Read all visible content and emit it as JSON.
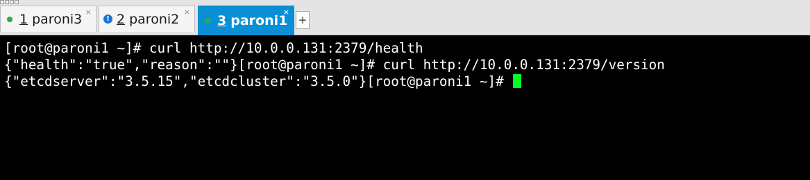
{
  "tabs": [
    {
      "number": "1",
      "label": "paroni3",
      "status": "green-dot-icon",
      "active": false,
      "close": "×"
    },
    {
      "number": "2",
      "label": "paroni2",
      "status": "info-icon",
      "active": false,
      "close": "×"
    },
    {
      "number": "3",
      "label": "paroni1",
      "status": "green-dot-icon",
      "active": true,
      "close": "×"
    }
  ],
  "add_tab_label": "+",
  "colors": {
    "active_tab": "#0a8fd6",
    "status_green": "#22b14c",
    "info_blue": "#1477d4",
    "cursor": "#00ff2a",
    "terminal_bg": "#000000",
    "terminal_fg": "#ffffff"
  },
  "terminal": {
    "lines": [
      "[root@paroni1 ~]# curl http://10.0.0.131:2379/health",
      "{\"health\":\"true\",\"reason\":\"\"}[root@paroni1 ~]# curl http://10.0.0.131:2379/version",
      "{\"etcdserver\":\"3.5.15\",\"etcdcluster\":\"3.5.0\"}[root@paroni1 ~]# "
    ]
  }
}
